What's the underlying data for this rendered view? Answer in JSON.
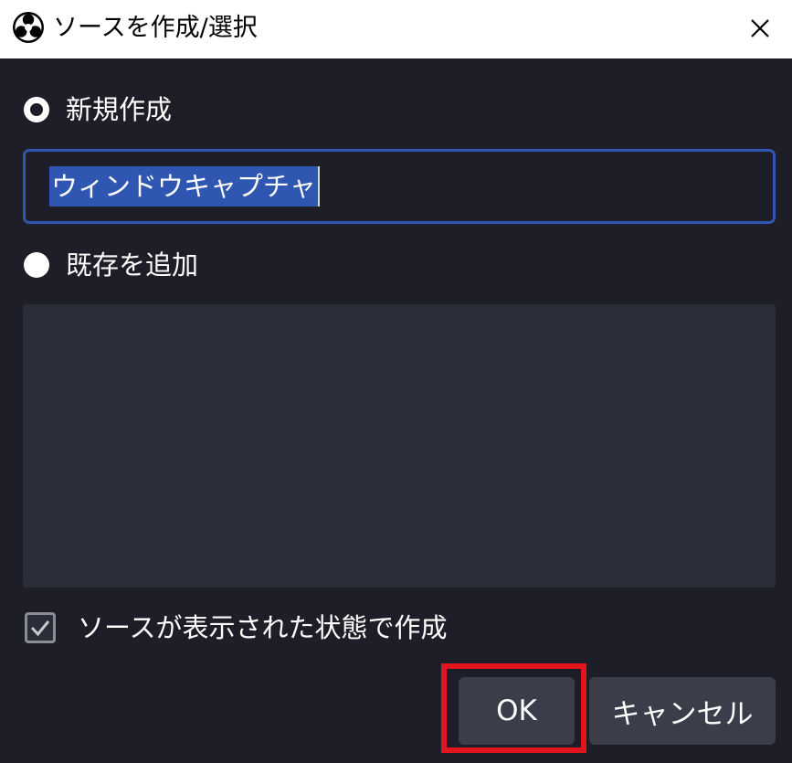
{
  "window": {
    "title": "ソースを作成/選択",
    "app_icon": "obs-logo-icon",
    "close_icon": "close-icon"
  },
  "options": {
    "create_new": {
      "label": "新規作成",
      "selected": true
    },
    "name_input": {
      "value": "ウィンドウキャプチャ",
      "text_selected": true
    },
    "add_existing": {
      "label": "既存を追加",
      "selected": false
    },
    "existing_sources": []
  },
  "visible_checkbox": {
    "label": "ソースが表示された状態で作成",
    "checked": true
  },
  "buttons": {
    "ok": "OK",
    "cancel": "キャンセル"
  },
  "colors": {
    "background": "#1d1e27",
    "panel": "#2b2d38",
    "button": "#3b3d4a",
    "focus_accent": "#2f56b0",
    "annotation_red": "#e3141b"
  }
}
